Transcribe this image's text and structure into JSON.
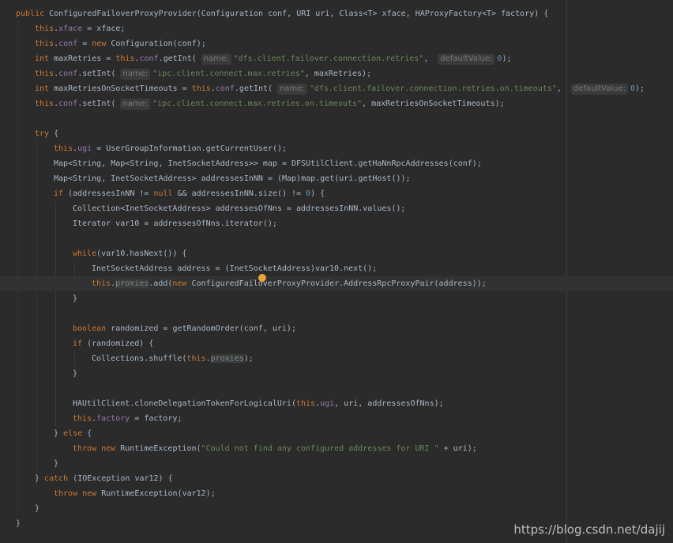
{
  "editor": {
    "language": "java",
    "current_line_index": 18,
    "watermark": "https://blog.csdn.net/dajij",
    "colors": {
      "background": "#2b2b2b",
      "keyword": "#cc7832",
      "string": "#6a8759",
      "number": "#6897bb",
      "field": "#9876aa",
      "text": "#a9b7c6",
      "hint": "#787878",
      "bulb": "#e8a33a"
    },
    "lines": [
      {
        "indent": 0,
        "tokens": [
          {
            "t": "public",
            "c": "kw"
          },
          {
            "t": " ConfiguredFailoverProxyProvider(Configuration conf, URI uri, Class<T> xface, HAProxyFactory<T> factory) {",
            "c": "plain"
          }
        ]
      },
      {
        "indent": 1,
        "tokens": [
          {
            "t": "this",
            "c": "kw"
          },
          {
            "t": ".",
            "c": "plain"
          },
          {
            "t": "xface",
            "c": "field"
          },
          {
            "t": " = xface;",
            "c": "plain"
          }
        ]
      },
      {
        "indent": 1,
        "tokens": [
          {
            "t": "this",
            "c": "kw"
          },
          {
            "t": ".",
            "c": "plain"
          },
          {
            "t": "conf",
            "c": "field"
          },
          {
            "t": " = ",
            "c": "plain"
          },
          {
            "t": "new",
            "c": "kw"
          },
          {
            "t": " Configuration(conf);",
            "c": "plain"
          }
        ]
      },
      {
        "indent": 1,
        "tokens": [
          {
            "t": "int",
            "c": "kw"
          },
          {
            "t": " maxRetries = ",
            "c": "plain"
          },
          {
            "t": "this",
            "c": "kw"
          },
          {
            "t": ".",
            "c": "plain"
          },
          {
            "t": "conf",
            "c": "field"
          },
          {
            "t": ".getInt( ",
            "c": "plain"
          },
          {
            "t": "name:",
            "c": "hint"
          },
          {
            "t": "\"dfs.client.failover.connection.retries\"",
            "c": "str"
          },
          {
            "t": ",  ",
            "c": "plain"
          },
          {
            "t": "defaultValue:",
            "c": "hint"
          },
          {
            "t": "0",
            "c": "num"
          },
          {
            "t": ");",
            "c": "plain"
          }
        ]
      },
      {
        "indent": 1,
        "tokens": [
          {
            "t": "this",
            "c": "kw"
          },
          {
            "t": ".",
            "c": "plain"
          },
          {
            "t": "conf",
            "c": "field"
          },
          {
            "t": ".setInt( ",
            "c": "plain"
          },
          {
            "t": "name:",
            "c": "hint"
          },
          {
            "t": "\"ipc.client.connect.max.retries\"",
            "c": "str"
          },
          {
            "t": ", maxRetries);",
            "c": "plain"
          }
        ]
      },
      {
        "indent": 1,
        "tokens": [
          {
            "t": "int",
            "c": "kw"
          },
          {
            "t": " maxRetriesOnSocketTimeouts = ",
            "c": "plain"
          },
          {
            "t": "this",
            "c": "kw"
          },
          {
            "t": ".",
            "c": "plain"
          },
          {
            "t": "conf",
            "c": "field"
          },
          {
            "t": ".getInt( ",
            "c": "plain"
          },
          {
            "t": "name:",
            "c": "hint"
          },
          {
            "t": "\"dfs.client.failover.connection.retries.on.timeouts\"",
            "c": "str"
          },
          {
            "t": ",  ",
            "c": "plain"
          },
          {
            "t": "defaultValue:",
            "c": "hint"
          },
          {
            "t": "0",
            "c": "num"
          },
          {
            "t": ");",
            "c": "plain"
          }
        ]
      },
      {
        "indent": 1,
        "tokens": [
          {
            "t": "this",
            "c": "kw"
          },
          {
            "t": ".",
            "c": "plain"
          },
          {
            "t": "conf",
            "c": "field"
          },
          {
            "t": ".setInt( ",
            "c": "plain"
          },
          {
            "t": "name:",
            "c": "hint"
          },
          {
            "t": "\"ipc.client.connect.max.retries.on.timeouts\"",
            "c": "str"
          },
          {
            "t": ", maxRetriesOnSocketTimeouts);",
            "c": "plain"
          }
        ]
      },
      {
        "indent": 0,
        "tokens": []
      },
      {
        "indent": 1,
        "tokens": [
          {
            "t": "try",
            "c": "kw"
          },
          {
            "t": " {",
            "c": "plain"
          }
        ]
      },
      {
        "indent": 2,
        "tokens": [
          {
            "t": "this",
            "c": "kw"
          },
          {
            "t": ".",
            "c": "plain"
          },
          {
            "t": "ugi",
            "c": "field"
          },
          {
            "t": " = UserGroupInformation.getCurrentUser();",
            "c": "plain"
          }
        ]
      },
      {
        "indent": 2,
        "tokens": [
          {
            "t": "Map<String, Map<String, InetSocketAddress>> map = DFSUtilClient.getHaNnRpcAddresses(conf);",
            "c": "plain"
          }
        ]
      },
      {
        "indent": 2,
        "tokens": [
          {
            "t": "Map<String, InetSocketAddress> addressesInNN = (Map)map.get(uri.getHost());",
            "c": "plain"
          }
        ]
      },
      {
        "indent": 2,
        "tokens": [
          {
            "t": "if",
            "c": "kw"
          },
          {
            "t": " (addressesInNN != ",
            "c": "plain"
          },
          {
            "t": "null",
            "c": "kw"
          },
          {
            "t": " && addressesInNN.size() != ",
            "c": "plain"
          },
          {
            "t": "0",
            "c": "num"
          },
          {
            "t": ") {",
            "c": "plain"
          }
        ]
      },
      {
        "indent": 3,
        "tokens": [
          {
            "t": "Collection<InetSocketAddress> addressesOfNns = addressesInNN.values();",
            "c": "plain"
          }
        ]
      },
      {
        "indent": 3,
        "tokens": [
          {
            "t": "Iterator var10 = addressesOfNns.iterator();",
            "c": "plain"
          }
        ]
      },
      {
        "indent": 0,
        "tokens": []
      },
      {
        "indent": 3,
        "tokens": [
          {
            "t": "while",
            "c": "kw"
          },
          {
            "t": "(var10.hasNext()) {",
            "c": "plain"
          }
        ]
      },
      {
        "indent": 4,
        "tokens": [
          {
            "t": "InetSocketAddress address = (InetSocketAddress)var10.next();",
            "c": "plain"
          }
        ]
      },
      {
        "indent": 4,
        "tokens": [
          {
            "t": "this",
            "c": "kw"
          },
          {
            "t": ".",
            "c": "plain"
          },
          {
            "t": "proxies",
            "c": "field-hl"
          },
          {
            "t": ".add(",
            "c": "plain"
          },
          {
            "t": "new",
            "c": "kw"
          },
          {
            "t": " ConfiguredFailoverProxyProvider.AddressRpcProxyPair(address));",
            "c": "plain"
          }
        ]
      },
      {
        "indent": 3,
        "tokens": [
          {
            "t": "}",
            "c": "plain"
          }
        ]
      },
      {
        "indent": 0,
        "tokens": []
      },
      {
        "indent": 3,
        "tokens": [
          {
            "t": "boolean",
            "c": "kw"
          },
          {
            "t": " randomized = getRandomOrder(conf, uri);",
            "c": "plain"
          }
        ]
      },
      {
        "indent": 3,
        "tokens": [
          {
            "t": "if",
            "c": "kw"
          },
          {
            "t": " (randomized) {",
            "c": "plain"
          }
        ]
      },
      {
        "indent": 4,
        "tokens": [
          {
            "t": "Collections.shuffle(",
            "c": "plain"
          },
          {
            "t": "this",
            "c": "kw"
          },
          {
            "t": ".",
            "c": "plain"
          },
          {
            "t": "proxies",
            "c": "field-hl"
          },
          {
            "t": ");",
            "c": "plain"
          }
        ]
      },
      {
        "indent": 3,
        "tokens": [
          {
            "t": "}",
            "c": "plain"
          }
        ]
      },
      {
        "indent": 0,
        "tokens": []
      },
      {
        "indent": 3,
        "tokens": [
          {
            "t": "HAUtilClient.cloneDelegationTokenForLogicalUri(",
            "c": "plain"
          },
          {
            "t": "this",
            "c": "kw"
          },
          {
            "t": ".",
            "c": "plain"
          },
          {
            "t": "ugi",
            "c": "field"
          },
          {
            "t": ", uri, addressesOfNns);",
            "c": "plain"
          }
        ]
      },
      {
        "indent": 3,
        "tokens": [
          {
            "t": "this",
            "c": "kw"
          },
          {
            "t": ".",
            "c": "plain"
          },
          {
            "t": "factory",
            "c": "field"
          },
          {
            "t": " = factory;",
            "c": "plain"
          }
        ]
      },
      {
        "indent": 2,
        "tokens": [
          {
            "t": "} ",
            "c": "plain"
          },
          {
            "t": "else",
            "c": "kw"
          },
          {
            "t": " {",
            "c": "plain"
          }
        ]
      },
      {
        "indent": 3,
        "tokens": [
          {
            "t": "throw",
            "c": "kw"
          },
          {
            "t": " ",
            "c": "plain"
          },
          {
            "t": "new",
            "c": "kw"
          },
          {
            "t": " RuntimeException(",
            "c": "plain"
          },
          {
            "t": "\"Could not find any configured addresses for URI \"",
            "c": "str"
          },
          {
            "t": " + uri);",
            "c": "plain"
          }
        ]
      },
      {
        "indent": 2,
        "tokens": [
          {
            "t": "}",
            "c": "plain"
          }
        ]
      },
      {
        "indent": 1,
        "tokens": [
          {
            "t": "} ",
            "c": "plain"
          },
          {
            "t": "catch",
            "c": "kw"
          },
          {
            "t": " (IOException var12) {",
            "c": "plain"
          }
        ]
      },
      {
        "indent": 2,
        "tokens": [
          {
            "t": "throw",
            "c": "kw"
          },
          {
            "t": " ",
            "c": "plain"
          },
          {
            "t": "new",
            "c": "kw"
          },
          {
            "t": " RuntimeException(var12);",
            "c": "plain"
          }
        ]
      },
      {
        "indent": 1,
        "tokens": [
          {
            "t": "}",
            "c": "plain"
          }
        ]
      },
      {
        "indent": 0,
        "tokens": [
          {
            "t": "}",
            "c": "plain"
          }
        ]
      }
    ]
  }
}
